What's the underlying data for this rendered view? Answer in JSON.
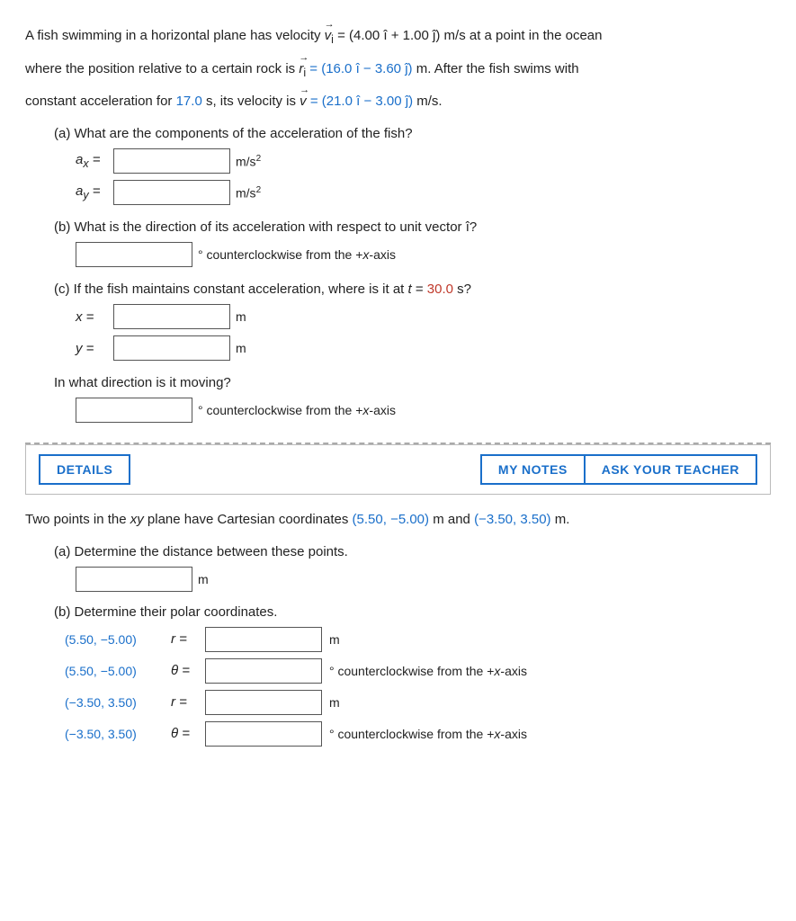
{
  "problem1": {
    "text_line1": "A fish swimming in a horizontal plane has velocity",
    "vi_label": "v⃗",
    "vi_sub": "i",
    "vi_value": "= (4.00 î + 1.00 ĵ) m/s at a point in the ocean",
    "text_line2": "where the position relative to a certain rock is",
    "ri_label": "r⃗",
    "ri_sub": "i",
    "ri_value_blue": "= (16.0 î − 3.60 ĵ)",
    "ri_value_rest": " m. After the fish swims with",
    "text_line3_start": "constant acceleration for",
    "time_blue": "17.0",
    "text_line3_mid": "s, its velocity is",
    "v_label": "v⃗",
    "vf_value_blue": "= (21.0 î − 3.00 ĵ)",
    "vf_value_rest": " m/s.",
    "part_a_label": "(a) What are the components of the acceleration of the fish?",
    "ax_label": "aₓ =",
    "ay_label": "aᵧ =",
    "unit_ms2": "m/s²",
    "part_b_label": "(b) What is the direction of its acceleration with respect to unit vector î?",
    "deg_label": "° counterclockwise from the +x-axis",
    "part_c_label": "(c) If the fish maintains constant acceleration, where is it at t = 30.0 s?",
    "t_highlight": "30.0",
    "x_label": "x =",
    "y_label": "y =",
    "unit_m": "m",
    "direction_label": "In what direction is it moving?",
    "dir_deg_label": "° counterclockwise from the +x-axis"
  },
  "toolbar": {
    "details_label": "DETAILS",
    "my_notes_label": "MY NOTES",
    "ask_teacher_label": "ASK YOUR TEACHER"
  },
  "problem2": {
    "text": "Two points in the xy plane have Cartesian coordinates",
    "coord1_blue": "(5.50, −5.00)",
    "text_mid": "m and",
    "coord2_blue": "(−3.50, 3.50)",
    "text_end": "m.",
    "part_a_label": "(a) Determine the distance between these points.",
    "unit_m": "m",
    "part_b_label": "(b) Determine their polar coordinates.",
    "coord1_label": "(5.50, −5.00)",
    "r1_label": "r =",
    "unit_m2": "m",
    "coord1b_label": "(5.50, −5.00)",
    "theta1_label": "θ =",
    "deg1_label": "° counterclockwise from the +x-axis",
    "coord2_label": "(−3.50, 3.50)",
    "r2_label": "r =",
    "unit_m3": "m",
    "coord2b_label": "(−3.50, 3.50)",
    "theta2_label": "θ =",
    "deg2_label": "° counterclockwise from the +x-axis"
  }
}
